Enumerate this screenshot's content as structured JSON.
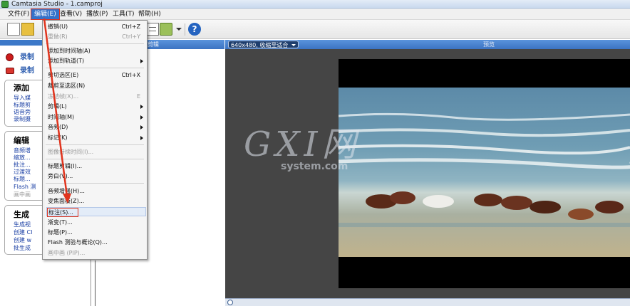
{
  "window": {
    "title": "Camtasia Studio - 1.camproj"
  },
  "menubar": {
    "items": [
      {
        "label": "文件(F)"
      },
      {
        "label": "编辑(E)"
      },
      {
        "label": "查看(V)"
      },
      {
        "label": "播放(P)"
      },
      {
        "label": "工具(T)"
      },
      {
        "label": "帮助(H)"
      }
    ]
  },
  "toolbar": {
    "help_glyph": "?"
  },
  "tasks": {
    "record_screen": "录制",
    "record_voice": "录制",
    "add_title": "添加",
    "add_links": [
      "导入媒",
      "标题剪",
      "语音旁",
      "录制摄"
    ],
    "edit_title": "编辑",
    "edit_links": [
      "音频增",
      "缩放...",
      "批注...",
      "过渡效",
      "标题...",
      "Flash 测",
      "画中画"
    ],
    "produce_title": "生成",
    "produce_links": [
      "生成视",
      "创建 CI",
      "创建 w",
      "批生成"
    ]
  },
  "timeline": {
    "title": "剪辑"
  },
  "preview": {
    "zoom_label": "640x480, 收缩至适合",
    "title": "预览"
  },
  "edit_menu": {
    "items": [
      {
        "label": "撤销(U)",
        "shortcut": "Ctrl+Z",
        "disabled": false
      },
      {
        "label": "重做(R)",
        "shortcut": "Ctrl+Y",
        "disabled": true
      },
      {
        "label": "添加到时间轴(A)",
        "shortcut": "",
        "disabled": false
      },
      {
        "label": "添加到轨道(T)",
        "shortcut": "",
        "disabled": false
      },
      {
        "label": "剪切选区(E)",
        "shortcut": "Ctrl+X",
        "disabled": false
      },
      {
        "label": "裁剪至选区(N)",
        "shortcut": "",
        "disabled": false
      },
      {
        "label": "冻结帧(X)...",
        "shortcut": "E",
        "disabled": true
      },
      {
        "label": "剪辑(L)",
        "shortcut": "",
        "disabled": false
      },
      {
        "label": "时间轴(M)",
        "shortcut": "",
        "disabled": false
      },
      {
        "label": "音频(D)",
        "shortcut": "",
        "disabled": false
      },
      {
        "label": "标记(K)",
        "shortcut": "",
        "disabled": false
      },
      {
        "label": "图像持续时间(I)...",
        "shortcut": "",
        "disabled": true
      },
      {
        "label": "标题剪辑(I)...",
        "shortcut": "",
        "disabled": false
      },
      {
        "label": "旁白(V)...",
        "shortcut": "",
        "disabled": false
      },
      {
        "label": "音频增强(H)...",
        "shortcut": "",
        "disabled": false
      },
      {
        "label": "变焦面板(Z)...",
        "shortcut": "",
        "disabled": false
      },
      {
        "label": "标注(S)...",
        "shortcut": "",
        "disabled": false
      },
      {
        "label": "渐变(T)...",
        "shortcut": "",
        "disabled": false
      },
      {
        "label": "标题(P)...",
        "shortcut": "",
        "disabled": false
      },
      {
        "label": "Flash 测验与概论(Q)...",
        "shortcut": "",
        "disabled": false
      },
      {
        "label": "画中画 (PIP)...",
        "shortcut": "",
        "disabled": true
      }
    ]
  },
  "watermark": {
    "big": "GXI网",
    "small": "system.com"
  },
  "colors": {
    "accent": "#3572c9",
    "highlight": "#e0341d",
    "panel_header": "#3b73c2"
  }
}
